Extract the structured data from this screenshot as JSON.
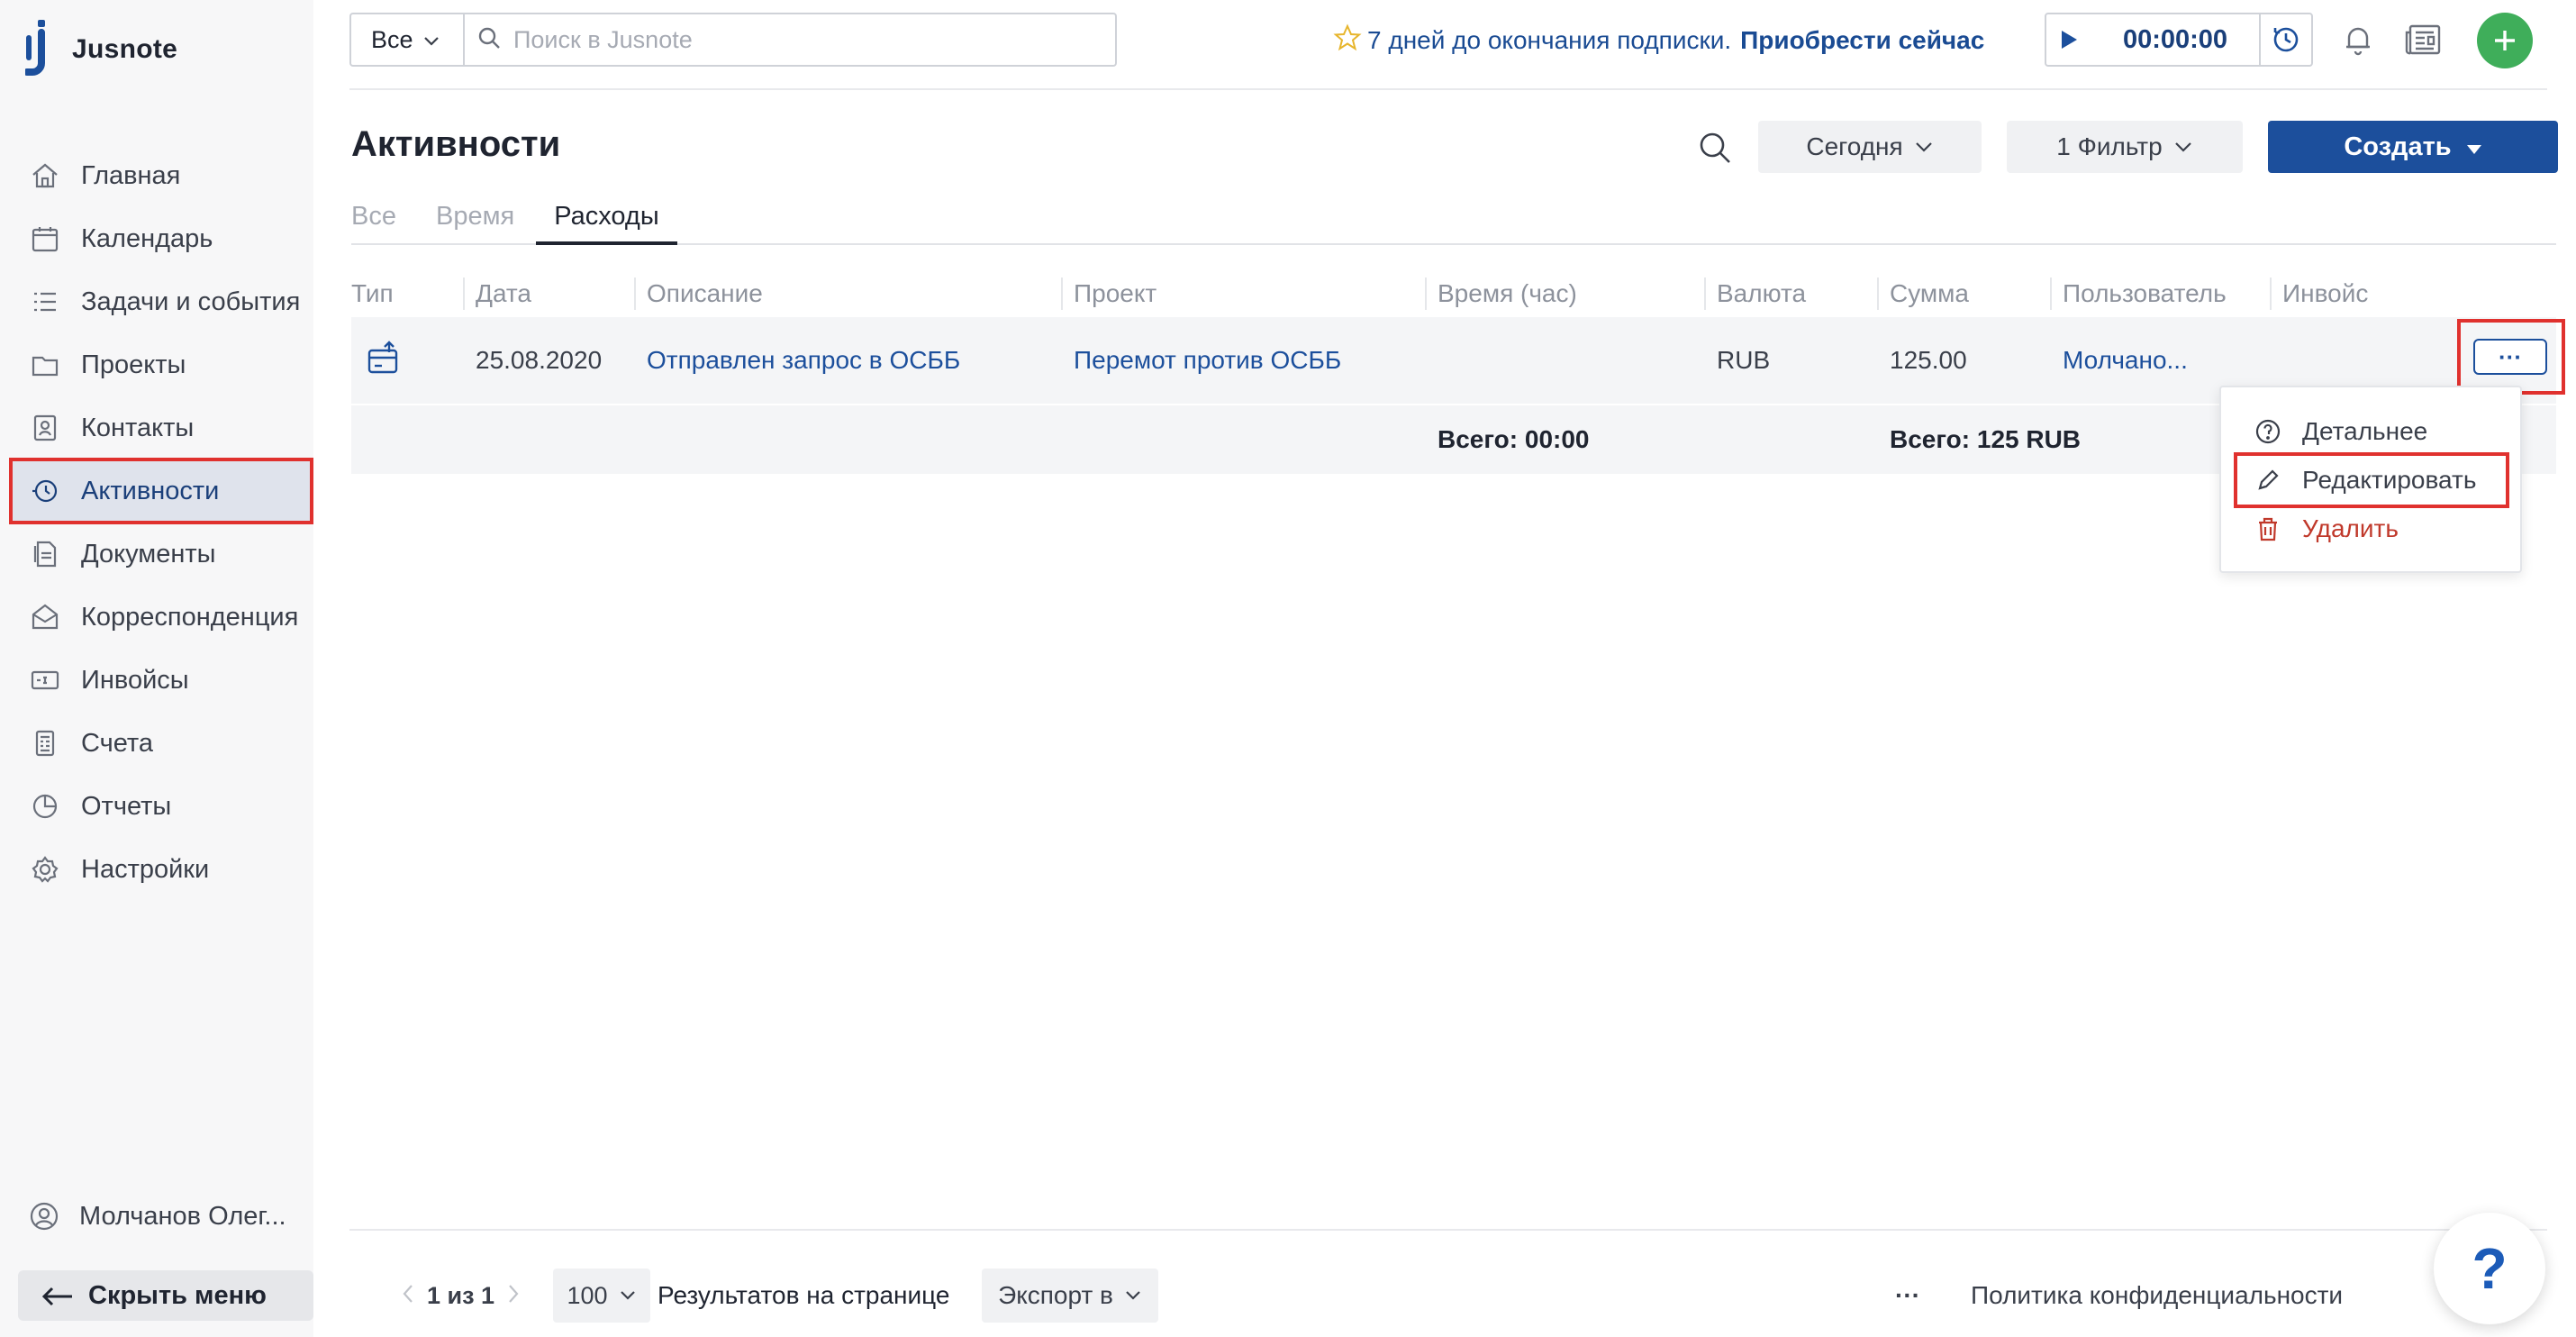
{
  "app": {
    "logo_text": "Jusnote"
  },
  "sidebar": {
    "items": [
      {
        "label": "Главная",
        "icon": "home-icon"
      },
      {
        "label": "Календарь",
        "icon": "calendar-icon"
      },
      {
        "label": "Задачи и события",
        "icon": "tasks-icon"
      },
      {
        "label": "Проекты",
        "icon": "projects-icon"
      },
      {
        "label": "Контакты",
        "icon": "contacts-icon"
      },
      {
        "label": "Активности",
        "icon": "activity-icon",
        "active": true
      },
      {
        "label": "Документы",
        "icon": "documents-icon"
      },
      {
        "label": "Корреспонденция",
        "icon": "mail-icon"
      },
      {
        "label": "Инвойсы",
        "icon": "invoice-icon"
      },
      {
        "label": "Счета",
        "icon": "accounts-icon"
      },
      {
        "label": "Отчеты",
        "icon": "reports-icon"
      },
      {
        "label": "Настройки",
        "icon": "settings-icon"
      }
    ],
    "user_name": "Молчанов Олег...",
    "hide_menu_label": "Скрыть меню"
  },
  "topbar": {
    "scope_value": "Все",
    "search_placeholder": "Поиск в Jusnote",
    "trial_text": "7 дней до окончания подписки.",
    "trial_link": "Приобрести сейчас",
    "timer_value": "00:00:00"
  },
  "header": {
    "title": "Активности",
    "date_filter": "Сегодня",
    "filter_label": "1 Фильтр",
    "create_label": "Создать"
  },
  "tabs": [
    {
      "label": "Все"
    },
    {
      "label": "Время"
    },
    {
      "label": "Расходы",
      "active": true
    }
  ],
  "table": {
    "columns": [
      "Тип",
      "Дата",
      "Описание",
      "Проект",
      "Время (час)",
      "Валюта",
      "Сумма",
      "Пользователь",
      "Инвойс"
    ],
    "rows": [
      {
        "type_icon": "expense-icon",
        "date": "25.08.2020",
        "description": "Отправлен запрос в ОСББ",
        "project": "Перемот против ОСББ",
        "time": "",
        "currency": "RUB",
        "amount": "125.00",
        "user": "Молчано...",
        "invoice": ""
      }
    ],
    "total_time": "Всего: 00:00",
    "total_amount": "Всего: 125 RUB",
    "row_actions_label": "···"
  },
  "row_menu": {
    "items": [
      {
        "label": "Детальнее",
        "icon": "info-icon"
      },
      {
        "label": "Редактировать",
        "icon": "pencil-icon"
      },
      {
        "label": "Удалить",
        "icon": "trash-icon"
      }
    ]
  },
  "footer": {
    "pager_text": "1 из 1",
    "per_page_value": "100",
    "per_page_label": "Результатов на странице",
    "export_label": "Экспорт в",
    "more_label": "···",
    "privacy_label": "Политика конфиденциальности",
    "help_label": "?"
  },
  "colors": {
    "brand_blue": "#1c4f9c",
    "highlight_red": "#e0312e",
    "success_green": "#3fae5a",
    "danger_red": "#c0392b"
  }
}
